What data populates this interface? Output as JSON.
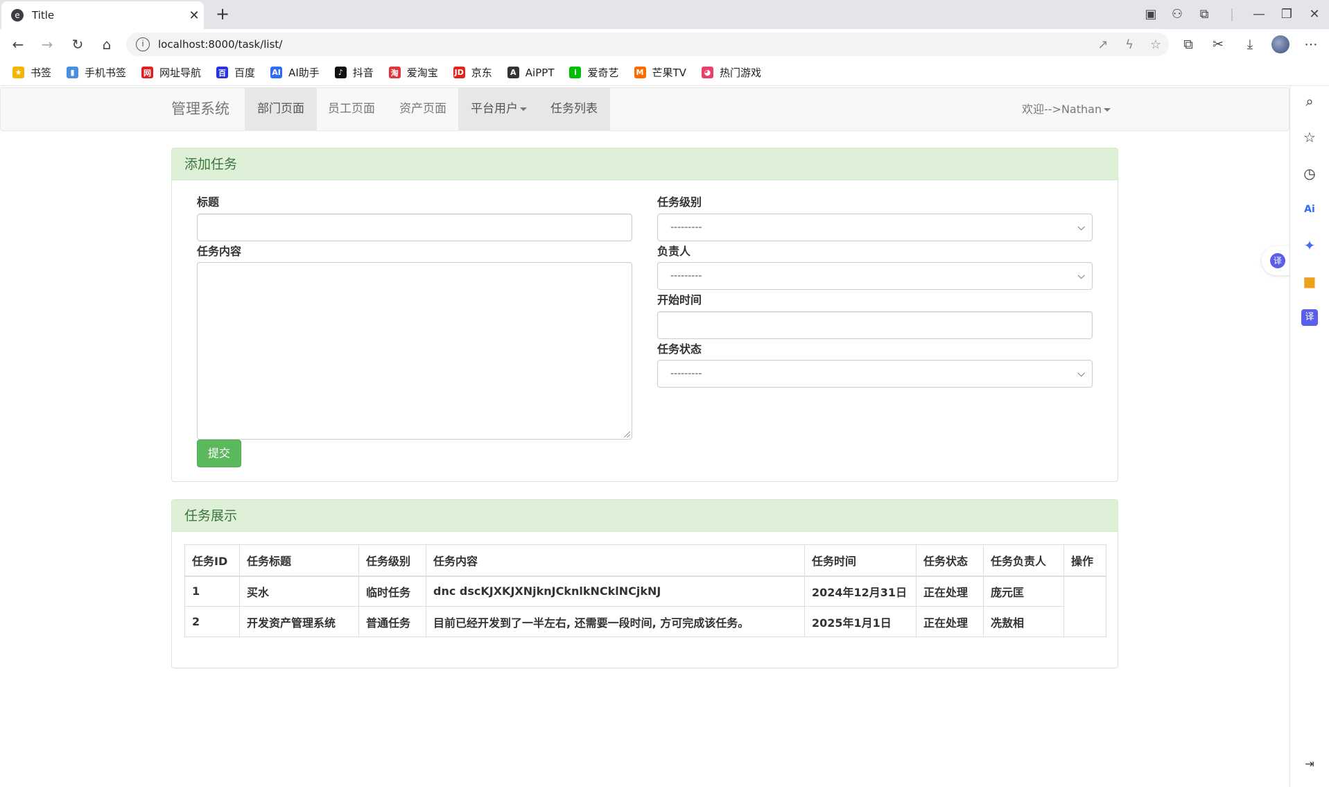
{
  "browser": {
    "tab_title": "Title",
    "url": "localhost:8000/task/list/",
    "bookmarks": [
      {
        "label": "书签",
        "color": "#f5b400",
        "glyph": "★"
      },
      {
        "label": "手机书签",
        "color": "#4a90e2",
        "glyph": "▮"
      },
      {
        "label": "网址导航",
        "color": "#e02020",
        "glyph": "网"
      },
      {
        "label": "百度",
        "color": "#2932e1",
        "glyph": "百"
      },
      {
        "label": "AI助手",
        "color": "#2f6cf5",
        "glyph": "AI"
      },
      {
        "label": "抖音",
        "color": "#111111",
        "glyph": "♪"
      },
      {
        "label": "爱淘宝",
        "color": "#e0353b",
        "glyph": "淘"
      },
      {
        "label": "京东",
        "color": "#e1251b",
        "glyph": "JD"
      },
      {
        "label": "AiPPT",
        "color": "#333333",
        "glyph": "A"
      },
      {
        "label": "爱奇艺",
        "color": "#00be06",
        "glyph": "i"
      },
      {
        "label": "芒果TV",
        "color": "#ff6a00",
        "glyph": "M"
      },
      {
        "label": "热门游戏",
        "color": "#e8406b",
        "glyph": "◕"
      }
    ]
  },
  "navbar": {
    "brand": "管理系统",
    "items": [
      "部门页面",
      "员工页面",
      "资产页面",
      "平台用户",
      "任务列表"
    ],
    "welcome": "欢迎-->Nathan"
  },
  "add_task": {
    "heading": "添加任务",
    "title_label": "标题",
    "content_label": "任务内容",
    "level_label": "任务级别",
    "level_value": "---------",
    "owner_label": "负责人",
    "owner_value": "---------",
    "start_label": "开始时间",
    "status_label": "任务状态",
    "status_value": "---------",
    "submit": "提交"
  },
  "task_list": {
    "heading": "任务展示",
    "columns": [
      "任务ID",
      "任务标题",
      "任务级别",
      "任务内容",
      "任务时间",
      "任务状态",
      "任务负责人",
      "操作"
    ],
    "rows": [
      [
        "1",
        "买水",
        "临时任务",
        "dnc dscKJXKJXNjknJCknlkNCklNCjkNJ",
        "2024年12月31日",
        "正在处理",
        "庞元匡",
        ""
      ],
      [
        "2",
        "开发资产管理系统",
        "普通任务",
        "目前已经开发到了一半左右, 还需要一段时间, 方可完成该任务。",
        "2025年1月1日",
        "正在处理",
        "冼敖相",
        ""
      ]
    ]
  }
}
